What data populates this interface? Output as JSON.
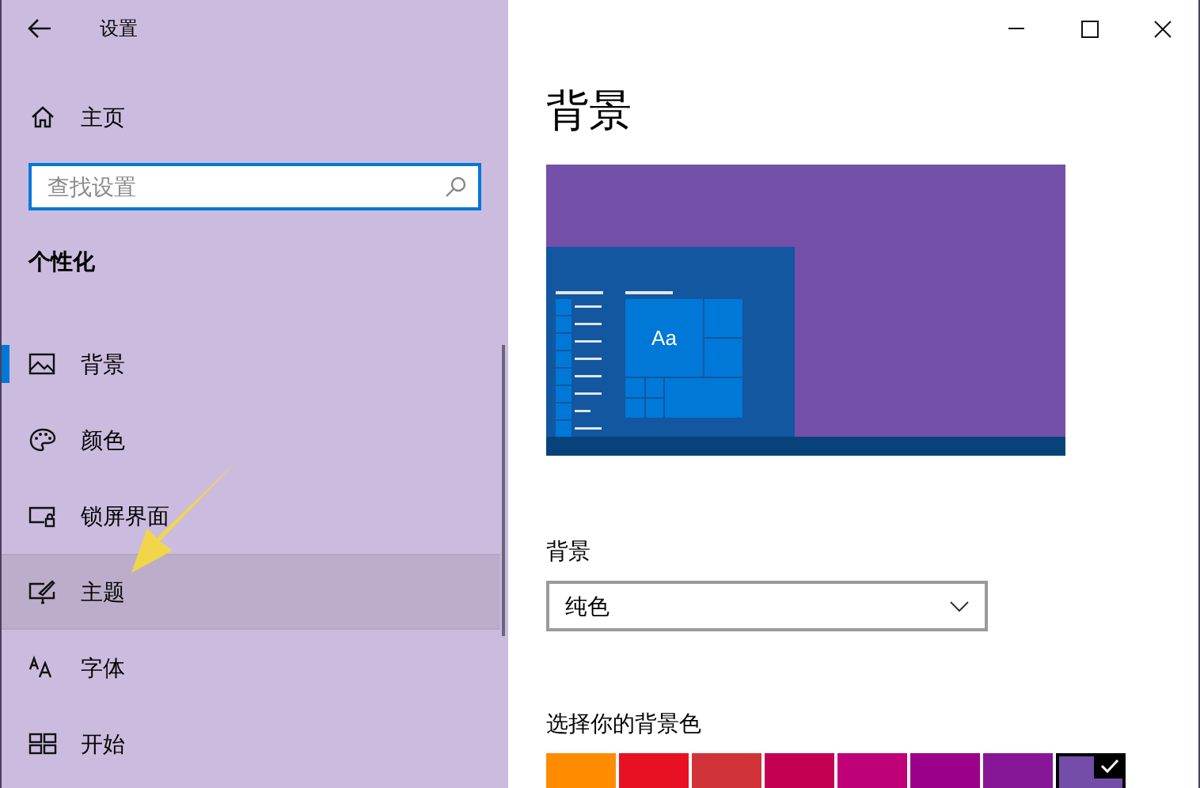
{
  "window": {
    "title": "设置"
  },
  "sidebar": {
    "home": "主页",
    "search": {
      "placeholder": "查找设置"
    },
    "section": "个性化",
    "items": [
      {
        "kind": "picture",
        "label": "背景",
        "selected": true,
        "highlighted": false
      },
      {
        "kind": "palette",
        "label": "颜色",
        "selected": false,
        "highlighted": false
      },
      {
        "kind": "lock",
        "label": "锁屏界面",
        "selected": false,
        "highlighted": false
      },
      {
        "kind": "theme",
        "label": "主题",
        "selected": false,
        "highlighted": true
      },
      {
        "kind": "font",
        "label": "字体",
        "selected": false,
        "highlighted": false
      },
      {
        "kind": "start",
        "label": "开始",
        "selected": false,
        "highlighted": false
      }
    ]
  },
  "page": {
    "title": "背景",
    "preview": {
      "tile_text": "Aa"
    },
    "background": {
      "label": "背景",
      "value": "纯色"
    },
    "colors": {
      "label": "选择你的背景色",
      "swatches": [
        {
          "color": "#ff8c00",
          "selected": false
        },
        {
          "color": "#e81123",
          "selected": false
        },
        {
          "color": "#d13438",
          "selected": false
        },
        {
          "color": "#c30052",
          "selected": false
        },
        {
          "color": "#bf0077",
          "selected": false
        },
        {
          "color": "#9a0089",
          "selected": false
        },
        {
          "color": "#881798",
          "selected": false
        },
        {
          "color": "#744da9",
          "selected": true
        }
      ]
    }
  }
}
